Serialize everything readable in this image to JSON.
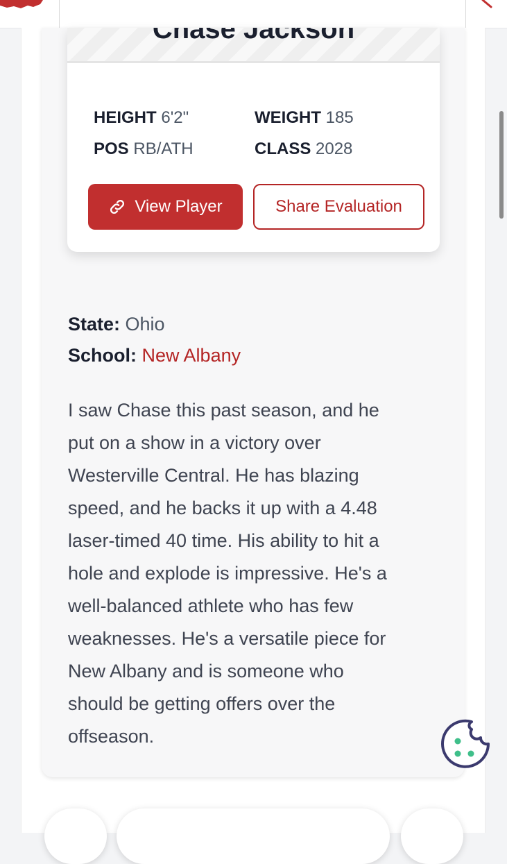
{
  "player": {
    "name": "Chase Jackson",
    "height_label": "HEIGHT",
    "height_value": "6'2\"",
    "weight_label": "WEIGHT",
    "weight_value": "185",
    "pos_label": "POS",
    "pos_value": "RB/ATH",
    "class_label": "CLASS",
    "class_value": "2028",
    "view_button": "View Player",
    "share_button": "Share Evaluation"
  },
  "details": {
    "state_label": "State:",
    "state_value": "Ohio",
    "school_label": "School:",
    "school_value": "New Albany"
  },
  "evaluation_lines": [
    "I saw Chase this past season, and he",
    "put on a show in a victory over",
    "Westerville Central. He has blazing",
    "speed, and he backs it up with a 4.48",
    "laser-timed 40 time. His ability to hit a",
    "hole and explode is impressive. He's a",
    "well-balanced athlete who has few",
    "weaknesses. He's a versatile piece for",
    "New Albany and is someone who",
    "should be getting offers over the",
    "offseason."
  ],
  "icons": {
    "view": "link-icon",
    "cookie": "cookie-icon",
    "logo": "ohio-logo-icon",
    "chevron": "chevron-right-icon"
  },
  "colors": {
    "accent": "#c12f2f",
    "accent_text": "#b42525",
    "heading": "#1a1f2e",
    "cookie": "#3b3a6e",
    "cookie_dots": "#3fbf8a"
  }
}
